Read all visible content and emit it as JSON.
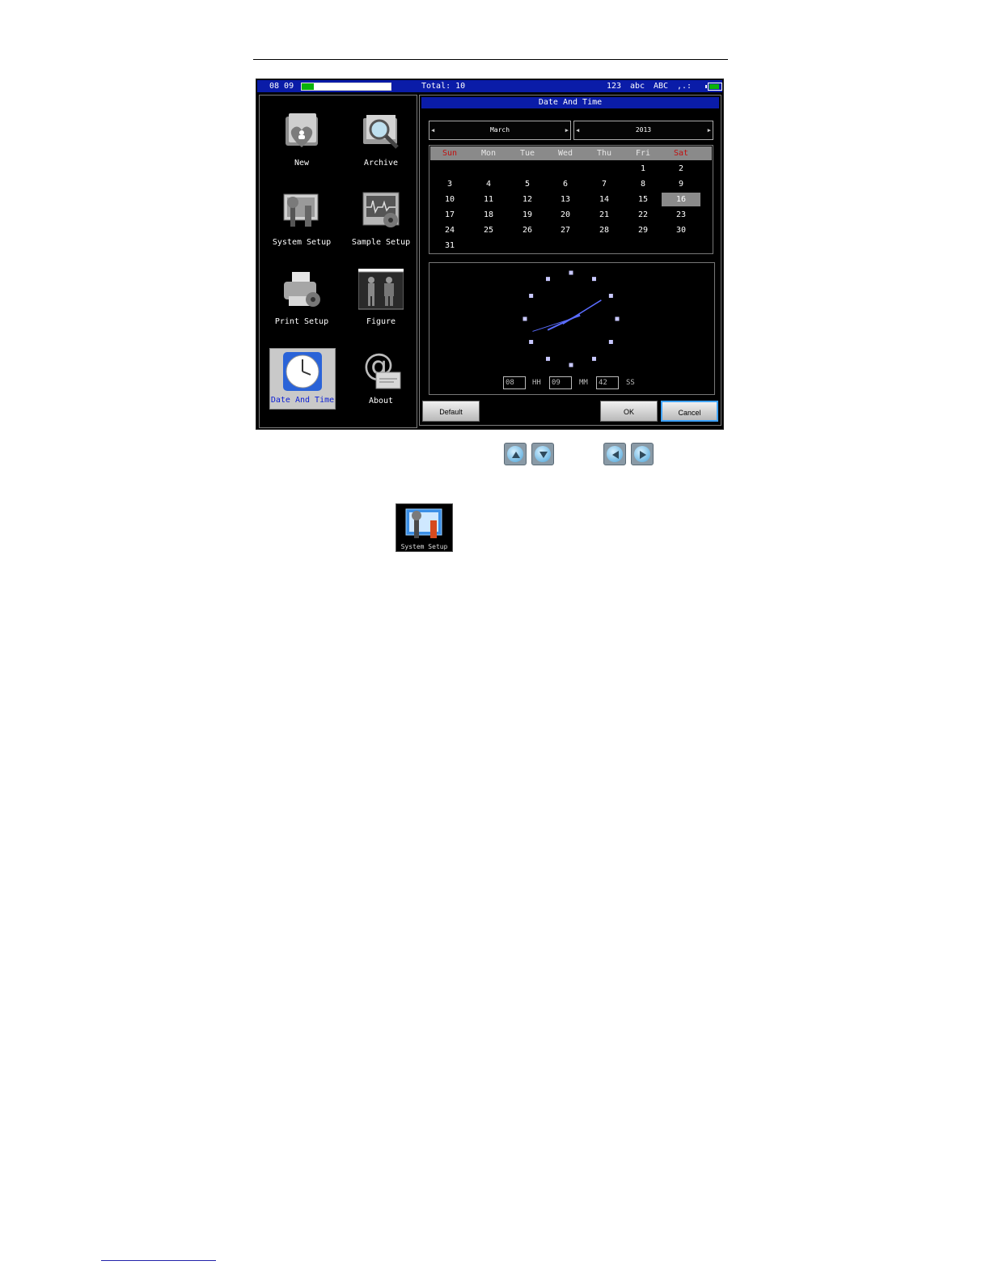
{
  "status_bar": {
    "time": "08 09",
    "progress_fraction": 0.14,
    "total": "Total: 10",
    "input_modes": [
      "123",
      "abc",
      "ABC",
      ",.:"
    ],
    "battery_fraction": 0.85
  },
  "menu": {
    "items": [
      {
        "label": "New",
        "icon": "new-record-icon"
      },
      {
        "label": "Archive",
        "icon": "archive-icon"
      },
      {
        "label": "System Setup",
        "icon": "system-setup-icon"
      },
      {
        "label": "Sample Setup",
        "icon": "sample-setup-icon"
      },
      {
        "label": "Print Setup",
        "icon": "printer-icon"
      },
      {
        "label": "Figure",
        "icon": "figure-icon"
      },
      {
        "label": "Date And Time",
        "icon": "clock-icon",
        "selected": true
      },
      {
        "label": "About",
        "icon": "about-icon"
      }
    ]
  },
  "dialog": {
    "title": "Date And Time",
    "month": "March",
    "year": "2013",
    "weekdays": [
      "Sun",
      "Mon",
      "Tue",
      "Wed",
      "Thu",
      "Fri",
      "Sat"
    ],
    "days": [
      "1",
      "2",
      "3",
      "4",
      "5",
      "6",
      "7",
      "8",
      "9",
      "10",
      "11",
      "12",
      "13",
      "14",
      "15",
      "16",
      "17",
      "18",
      "19",
      "20",
      "21",
      "22",
      "23",
      "24",
      "25",
      "26",
      "27",
      "28",
      "29",
      "30",
      "31"
    ],
    "selected_day": "16",
    "time": {
      "hh": "08",
      "hh_unit": "HH",
      "mm": "09",
      "mm_unit": "MM",
      "ss": "42",
      "ss_unit": "SS"
    },
    "buttons": {
      "default": "Default",
      "ok": "OK",
      "cancel": "Cancel"
    }
  },
  "nav_buttons": [
    "up-arrow-icon",
    "down-arrow-icon",
    "left-arrow-icon",
    "right-arrow-icon"
  ],
  "system_setup_icon": {
    "label": "System Setup"
  },
  "colors": {
    "status_blue": "#0a1ca8",
    "selected_text": "#0d20d4",
    "weekend_red": "#c01010",
    "focus_border": "#3fa3ff"
  }
}
